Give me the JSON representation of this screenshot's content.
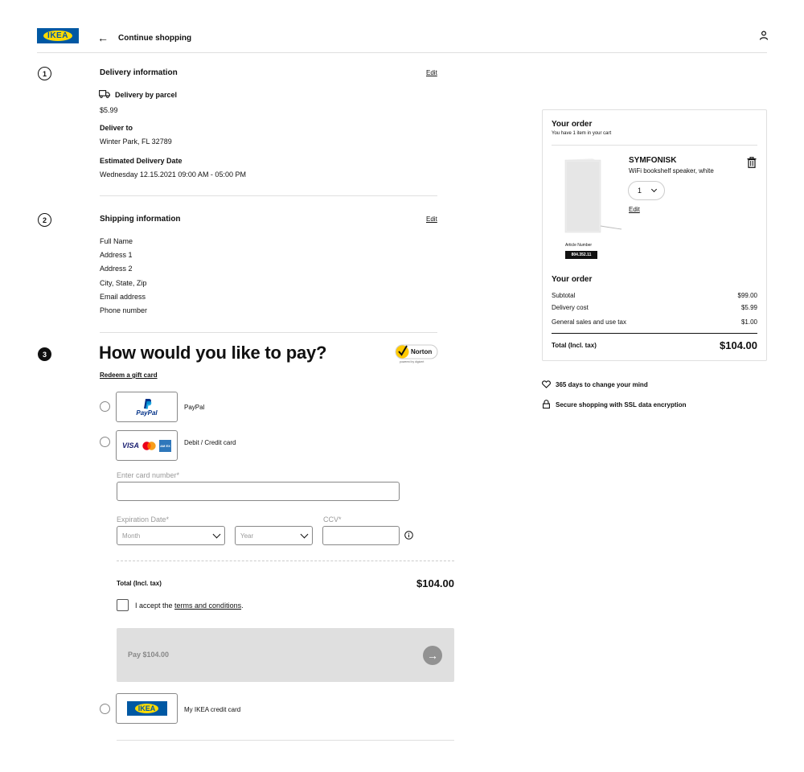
{
  "header": {
    "logo_text": "IKEA",
    "back_label": "Continue shopping",
    "icons": {
      "back": "arrow-left-icon",
      "user": "user-icon"
    }
  },
  "steps": [
    {
      "number": "1"
    },
    {
      "number": "2"
    },
    {
      "number": "3"
    }
  ],
  "delivery": {
    "title": "Delivery information",
    "edit_label": "Edit",
    "method": "Delivery by parcel",
    "price": "$5.99",
    "deliver_to_label": "Deliver to",
    "deliver_to_value": "Winter Park, FL 32789",
    "eta_label": "Estimated Delivery Date",
    "eta_value": "Wednesday 12.15.2021 09:00 AM - 05:00 PM"
  },
  "shipping": {
    "title": "Shipping information",
    "edit_label": "Edit",
    "lines": [
      "Full Name",
      "Address 1",
      "Address 2",
      "City, State, Zip",
      "Email address",
      "Phone number"
    ]
  },
  "payment": {
    "title": "How would you like to pay?",
    "gift_card_link": "Redeem a gift card",
    "norton_text": "Norton",
    "norton_sub": "powered by digicert",
    "options": [
      {
        "label": "PayPal",
        "logo_text": "PayPal"
      },
      {
        "label": "Debit / Credit card",
        "logo_texts": [
          "VISA",
          "AM EX"
        ]
      },
      {
        "label": "My IKEA credit card",
        "logo_text": "IKEA"
      }
    ],
    "card_number_label": "Enter card number*",
    "expiration_label": "Expiration Date*",
    "month_placeholder": "Month",
    "year_placeholder": "Year",
    "ccv_label": "CCV*",
    "total_label": "Total (Incl. tax)",
    "total_value": "$104.00",
    "terms_prefix": "I accept the ",
    "terms_link": "terms and conditions",
    "terms_suffix": ".",
    "pay_button_label": "Pay $104.00"
  },
  "order": {
    "title": "Your order",
    "subtitle": "You have 1 item in your cart",
    "product_name": "SYMFONISK",
    "product_desc": "WiFi bookshelf speaker, white",
    "quantity": "1",
    "edit_label": "Edit",
    "article_label": "Article Number",
    "article_number": "804.352.11",
    "summary_title": "Your order",
    "rows": [
      {
        "label": "Subtotal",
        "value": "$99.00"
      },
      {
        "label": "Delivery cost",
        "value": "$5.99"
      },
      {
        "label": "General sales and use tax",
        "value": "$1.00"
      }
    ],
    "total_label": "Total (Incl. tax)",
    "total_value": "$104.00"
  },
  "usps": [
    {
      "icon": "heart-icon",
      "text": "365 days to change your mind"
    },
    {
      "icon": "lock-icon",
      "text": "Secure shopping with SSL data encryption"
    }
  ],
  "colors": {
    "ikea_blue": "#0058a3",
    "ikea_yellow": "#ffdb00",
    "button_disabled": "#dfdfdf"
  }
}
